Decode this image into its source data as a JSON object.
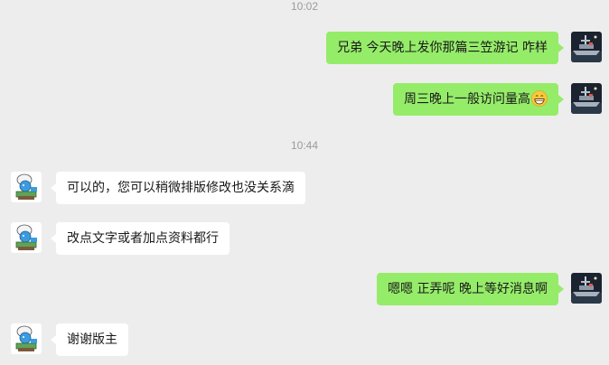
{
  "chat": {
    "timestamps": [
      "10:02",
      "10:44"
    ],
    "messages": [
      {
        "sender": "me",
        "text": "兄弟 今天晚上发你那篇三笠游记 咋样"
      },
      {
        "sender": "me",
        "text": "周三晚上一般访问量高",
        "emoji": "grinning-face-emoji"
      },
      {
        "sender": "other",
        "text": "可以的，您可以稍微排版修改也没关系滴"
      },
      {
        "sender": "other",
        "text": "改点文字或者加点资料都行"
      },
      {
        "sender": "me",
        "text": "嗯嗯 正弄呢 晚上等好消息啊"
      },
      {
        "sender": "other",
        "text": "谢谢版主"
      }
    ]
  },
  "colors": {
    "background": "#ededed",
    "my_bubble": "#95ec69",
    "their_bubble": "#ffffff",
    "timestamp": "#9b9b9b"
  },
  "icons": {
    "my_avatar": "warship-night-avatar",
    "their_avatar": "smurf-avatar"
  }
}
